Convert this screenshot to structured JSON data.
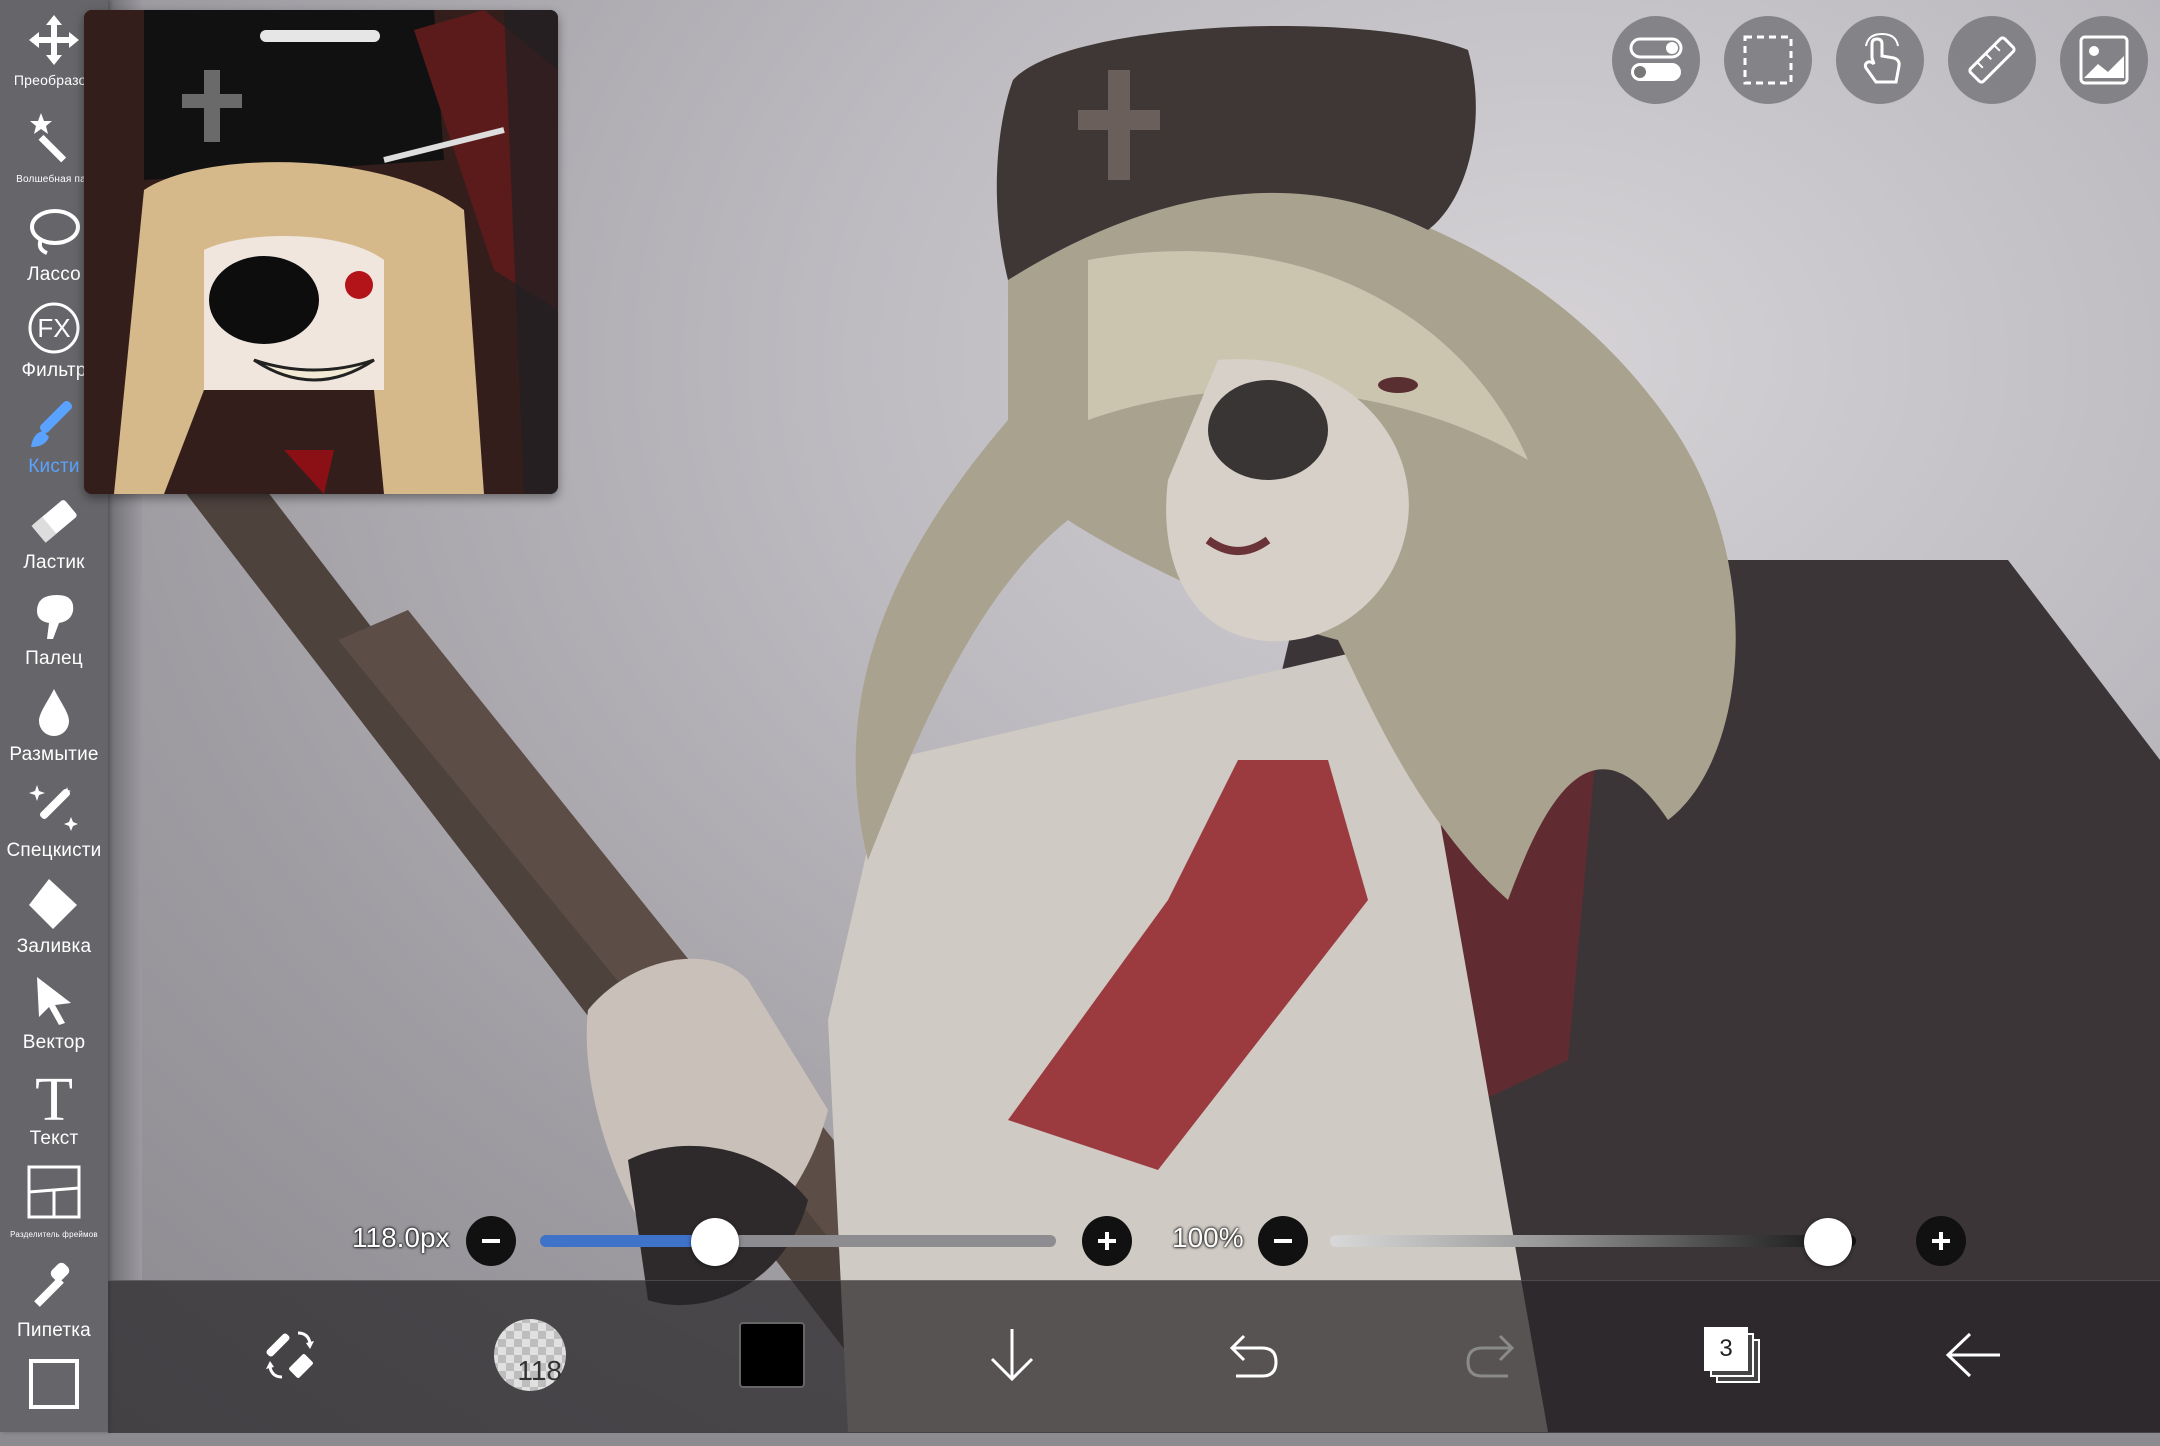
{
  "toolbar": {
    "items": [
      {
        "label": "Преобразов",
        "icon": "move-arrows-icon"
      },
      {
        "label": "Волшебная пал",
        "icon": "magic-wand-icon"
      },
      {
        "label": "Лассо",
        "icon": "lasso-icon"
      },
      {
        "label": "Фильтр",
        "icon": "fx-filter-icon"
      },
      {
        "label": "Кисти",
        "icon": "brush-icon",
        "active": true
      },
      {
        "label": "Ластик",
        "icon": "eraser-icon"
      },
      {
        "label": "Палец",
        "icon": "smudge-finger-icon"
      },
      {
        "label": "Размытие",
        "icon": "blur-drop-icon"
      },
      {
        "label": "Спецкисти",
        "icon": "special-brush-icon"
      },
      {
        "label": "Заливка",
        "icon": "fill-bucket-icon"
      },
      {
        "label": "Вектор",
        "icon": "vector-cursor-icon"
      },
      {
        "label": "Текст",
        "icon": "text-icon"
      },
      {
        "label": "Разделитель фреймов",
        "icon": "frame-divider-icon"
      },
      {
        "label": "Пипетка",
        "icon": "eyedropper-icon"
      },
      {
        "label": "",
        "icon": "canvas-frame-icon"
      }
    ]
  },
  "top_buttons": [
    "toggle-settings-icon",
    "selection-rect-icon",
    "touch-gesture-icon",
    "ruler-icon",
    "image-reference-icon"
  ],
  "sliders": {
    "brush_size": {
      "label": "118.0px",
      "fraction": 0.34
    },
    "opacity": {
      "label": "100%",
      "fraction": 1.0
    }
  },
  "bottom_bar": {
    "brush_size_badge": "118",
    "current_color": "#000000",
    "layer_count": "3"
  },
  "colors": {
    "accent": "#5aa2ff",
    "slider_fill": "#3f72c9"
  }
}
